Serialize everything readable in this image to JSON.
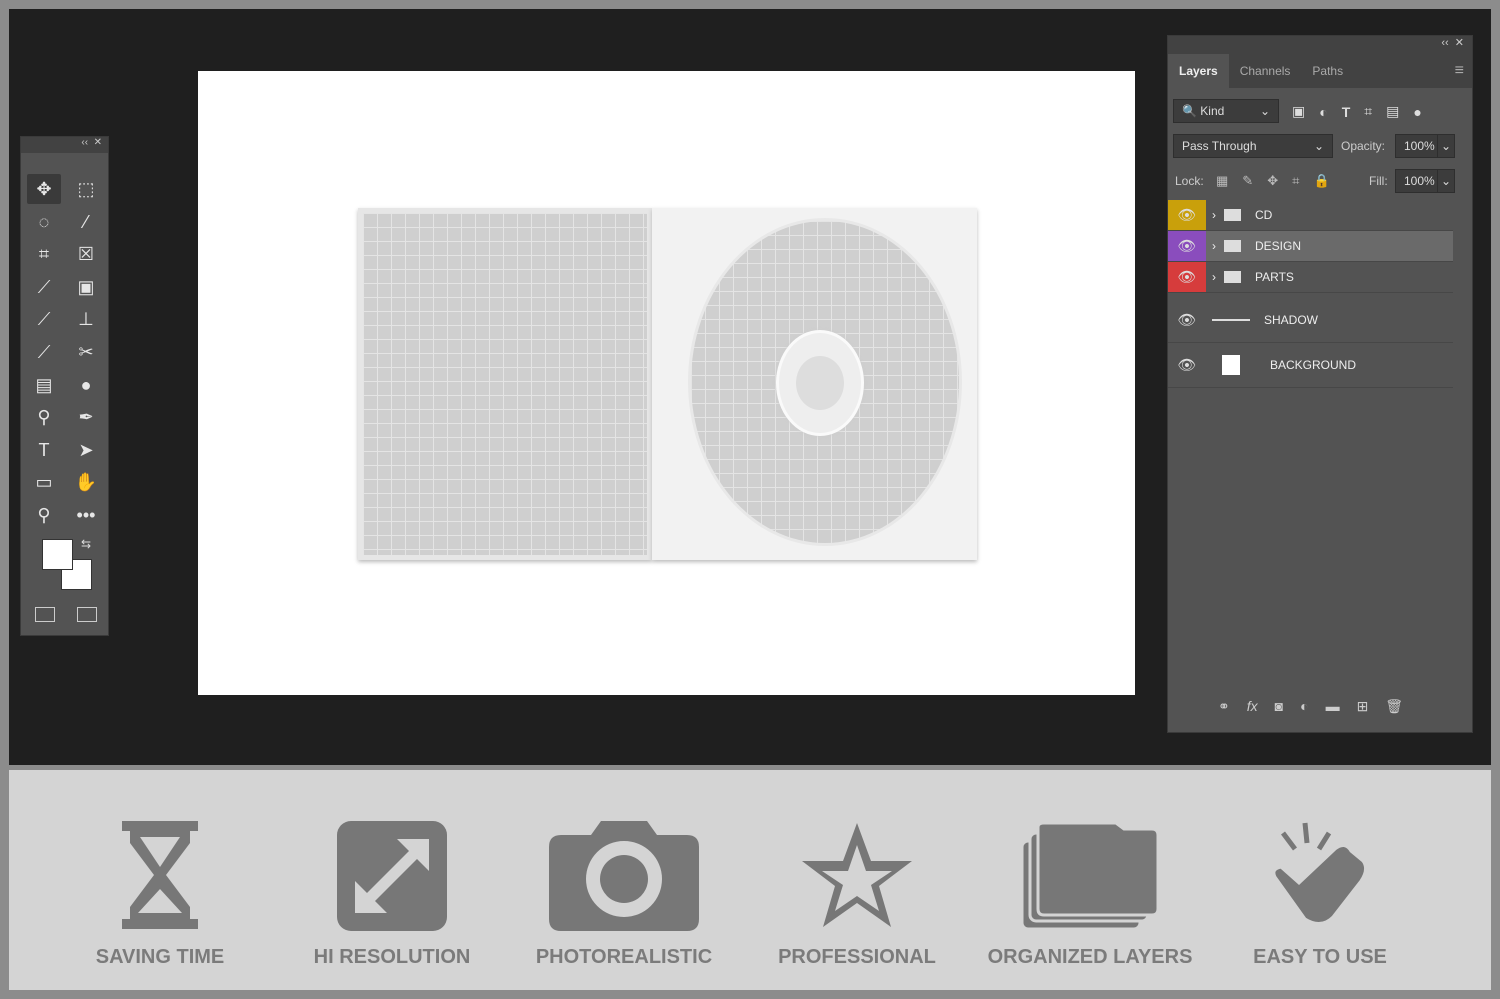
{
  "toolbar": {
    "collapse": "‹‹",
    "close": "✕",
    "tools": [
      "move",
      "marquee",
      "lasso",
      "magic-wand",
      "crop",
      "frame",
      "eyedropper",
      "patch",
      "brush",
      "stamp",
      "history-brush",
      "eraser",
      "gradient",
      "blur",
      "dodge",
      "pen",
      "type",
      "path-select",
      "rectangle",
      "hand-rotate",
      "zoom",
      "more"
    ]
  },
  "layers_panel": {
    "collapse": "‹‹",
    "close": "✕",
    "tabs": [
      "Layers",
      "Channels",
      "Paths"
    ],
    "filter": "Kind",
    "blend_mode": "Pass Through",
    "opacity_label": "Opacity:",
    "opacity": "100%",
    "lock_label": "Lock:",
    "fill_label": "Fill:",
    "fill": "100%",
    "layers": [
      {
        "name": "CD",
        "type": "group",
        "color": "#c9a00b"
      },
      {
        "name": "DESIGN",
        "type": "group",
        "color": "#8a4dbd",
        "selected": true
      },
      {
        "name": "PARTS",
        "type": "group",
        "color": "#d63c3c"
      },
      {
        "name": "SHADOW",
        "type": "layer"
      },
      {
        "name": "BACKGROUND",
        "type": "layer"
      }
    ]
  },
  "features": [
    {
      "icon": "hourglass-icon",
      "label": "SAVING TIME"
    },
    {
      "icon": "expand-icon",
      "label": "HI RESOLUTION"
    },
    {
      "icon": "camera-icon",
      "label": "PHOTOREALISTIC"
    },
    {
      "icon": "star-icon",
      "label": "PROFESSIONAL"
    },
    {
      "icon": "layers-icon",
      "label": "ORGANIZED LAYERS"
    },
    {
      "icon": "tap-hand-icon",
      "label": "EASY TO USE"
    }
  ]
}
